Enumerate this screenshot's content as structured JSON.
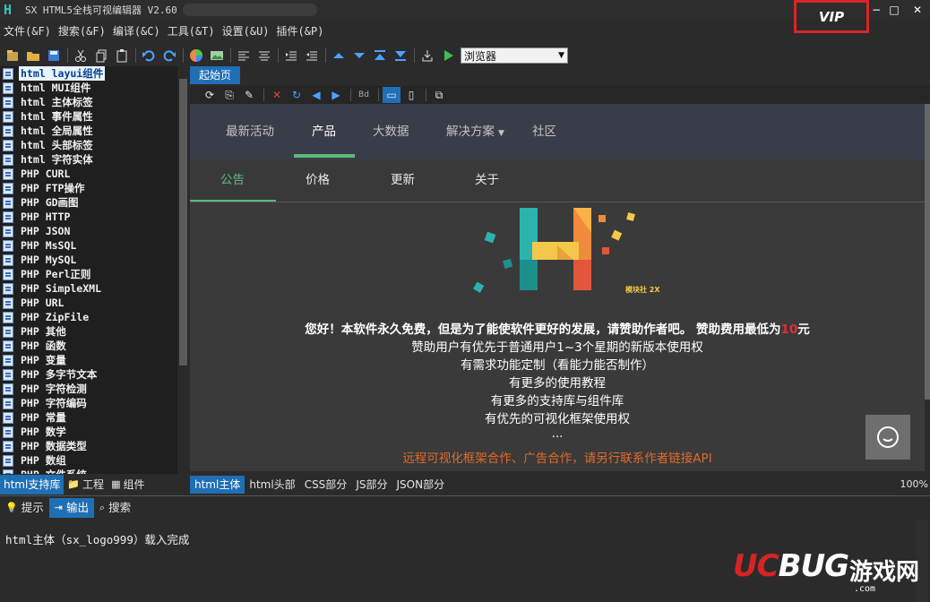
{
  "titlebar": {
    "title": "SX HTML5全栈可视编辑器 V2.60",
    "vip": "VIP",
    "minimize": "−",
    "maximize": "□",
    "close": "✕"
  },
  "menu": [
    "文件(&F)",
    "搜索(&F)",
    "编译(&C)",
    "工具(&T)",
    "设置(&U)",
    "插件(&P)"
  ],
  "toolbar": {
    "browser_select": "浏览器"
  },
  "tree": {
    "selected_index": 0,
    "items": [
      "html layui组件",
      "html MUI组件",
      "html 主体标签",
      "html 事件属性",
      "html 全局属性",
      "html 头部标签",
      "html 字符实体",
      "PHP CURL",
      "PHP FTP操作",
      "PHP GD画图",
      "PHP HTTP",
      "PHP JSON",
      "PHP MsSQL",
      "PHP MySQL",
      "PHP Perl正则",
      "PHP SimpleXML",
      "PHP URL",
      "PHP ZipFile",
      "PHP 其他",
      "PHP 函数",
      "PHP 变量",
      "PHP 多字节文本",
      "PHP 字符检测",
      "PHP 字符编码",
      "PHP 常量",
      "PHP 数学",
      "PHP 数据类型",
      "PHP 数组",
      "PHP 文件系统"
    ]
  },
  "left_tabs": [
    "html支持库",
    "工程",
    "组件"
  ],
  "editor": {
    "doc_tab": "起始页",
    "nav_main": [
      "最新活动",
      "产品",
      "大数据",
      "解决方案",
      "社区"
    ],
    "nav_sub": [
      "公告",
      "价格",
      "更新",
      "关于"
    ],
    "logo_caption": "模块社 2X",
    "line1_a": "您好！本软件永久免费，但是为了能使软件更好的发展，请赞助作者吧。 赞助费用最低为",
    "line1_red": "10",
    "line1_b": "元",
    "line2": "赞助用户有优先于普通用户1~3个星期的新版本使用权",
    "line3": "有需求功能定制（看能力能否制作）",
    "line4": "有更多的使用教程",
    "line5": "有更多的支持库与组件库",
    "line6": "有优先的可视化框架使用权",
    "line7": "...",
    "line8": "远程可视化框架合作、广告合作，请另行联系作者链接API"
  },
  "bottom_tabs": [
    "html主体",
    "html头部",
    "CSS部分",
    "JS部分",
    "JSON部分"
  ],
  "zoom": "100%",
  "output": {
    "tabs": [
      "提示",
      "输出",
      "搜索"
    ],
    "line": "html主体（sx_logo999）载入完成"
  },
  "watermark": {
    "brand_a": "UC",
    "brand_b": "BUG",
    "brand_cn": "游戏网",
    "site": ".com"
  }
}
